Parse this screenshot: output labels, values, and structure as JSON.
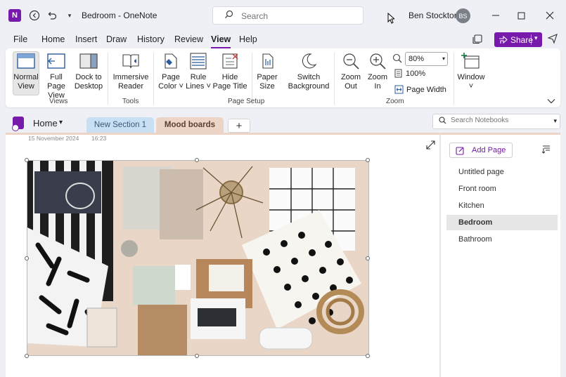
{
  "titlebar": {
    "app_badge": "N",
    "title": "Bedroom  -  OneNote",
    "search_placeholder": "Search",
    "user_name": "Ben Stockton",
    "user_initials": "BS"
  },
  "menu": {
    "items": [
      "File",
      "Home",
      "Insert",
      "Draw",
      "History",
      "Review",
      "View",
      "Help"
    ],
    "active": "View",
    "share_label": "Share"
  },
  "ribbon": {
    "views": [
      {
        "label1": "Normal",
        "label2": "View",
        "selected": true
      },
      {
        "label1": "Full Page",
        "label2": "View"
      },
      {
        "label1": "Dock to",
        "label2": "Desktop"
      }
    ],
    "views_group": "Views",
    "tools": [
      {
        "label1": "Immersive",
        "label2": "Reader"
      }
    ],
    "tools_group": "Tools",
    "page_setup": [
      {
        "label1": "Page",
        "label2": "Color ˅"
      },
      {
        "label1": "Rule",
        "label2": "Lines ˅"
      },
      {
        "label1": "Hide",
        "label2": "Page Title"
      },
      {
        "label1": "Paper",
        "label2": "Size"
      },
      {
        "label1": "Switch",
        "label2": "Background"
      }
    ],
    "page_setup_group": "Page Setup",
    "zoom": [
      {
        "label1": "Zoom",
        "label2": "Out"
      },
      {
        "label1": "Zoom",
        "label2": "In"
      }
    ],
    "zoom_value": "80%",
    "zoom_100": "100%",
    "page_width": "Page Width",
    "zoom_group": "Zoom",
    "window_label": "Window",
    "window_chevron": "˅"
  },
  "notebook": {
    "name": "Home",
    "tabs": [
      "New Section 1",
      "Mood boards"
    ],
    "active_tab": "Mood boards",
    "add_tab": "+",
    "search_placeholder": "Search Notebooks"
  },
  "page": {
    "date": "15 November 2024",
    "time": "16:23",
    "image_alt": "Bedroom mood board photo with pillows, fabrics and samples"
  },
  "pages": {
    "add_label": "Add Page",
    "items": [
      "Untitled page",
      "Front room",
      "Kitchen",
      "Bedroom",
      "Bathroom"
    ],
    "selected": "Bedroom"
  },
  "colors": {
    "accent": "#7719aa",
    "section_tab_blue": "#c9dff3",
    "section_tab_active": "#ecd5c6"
  }
}
